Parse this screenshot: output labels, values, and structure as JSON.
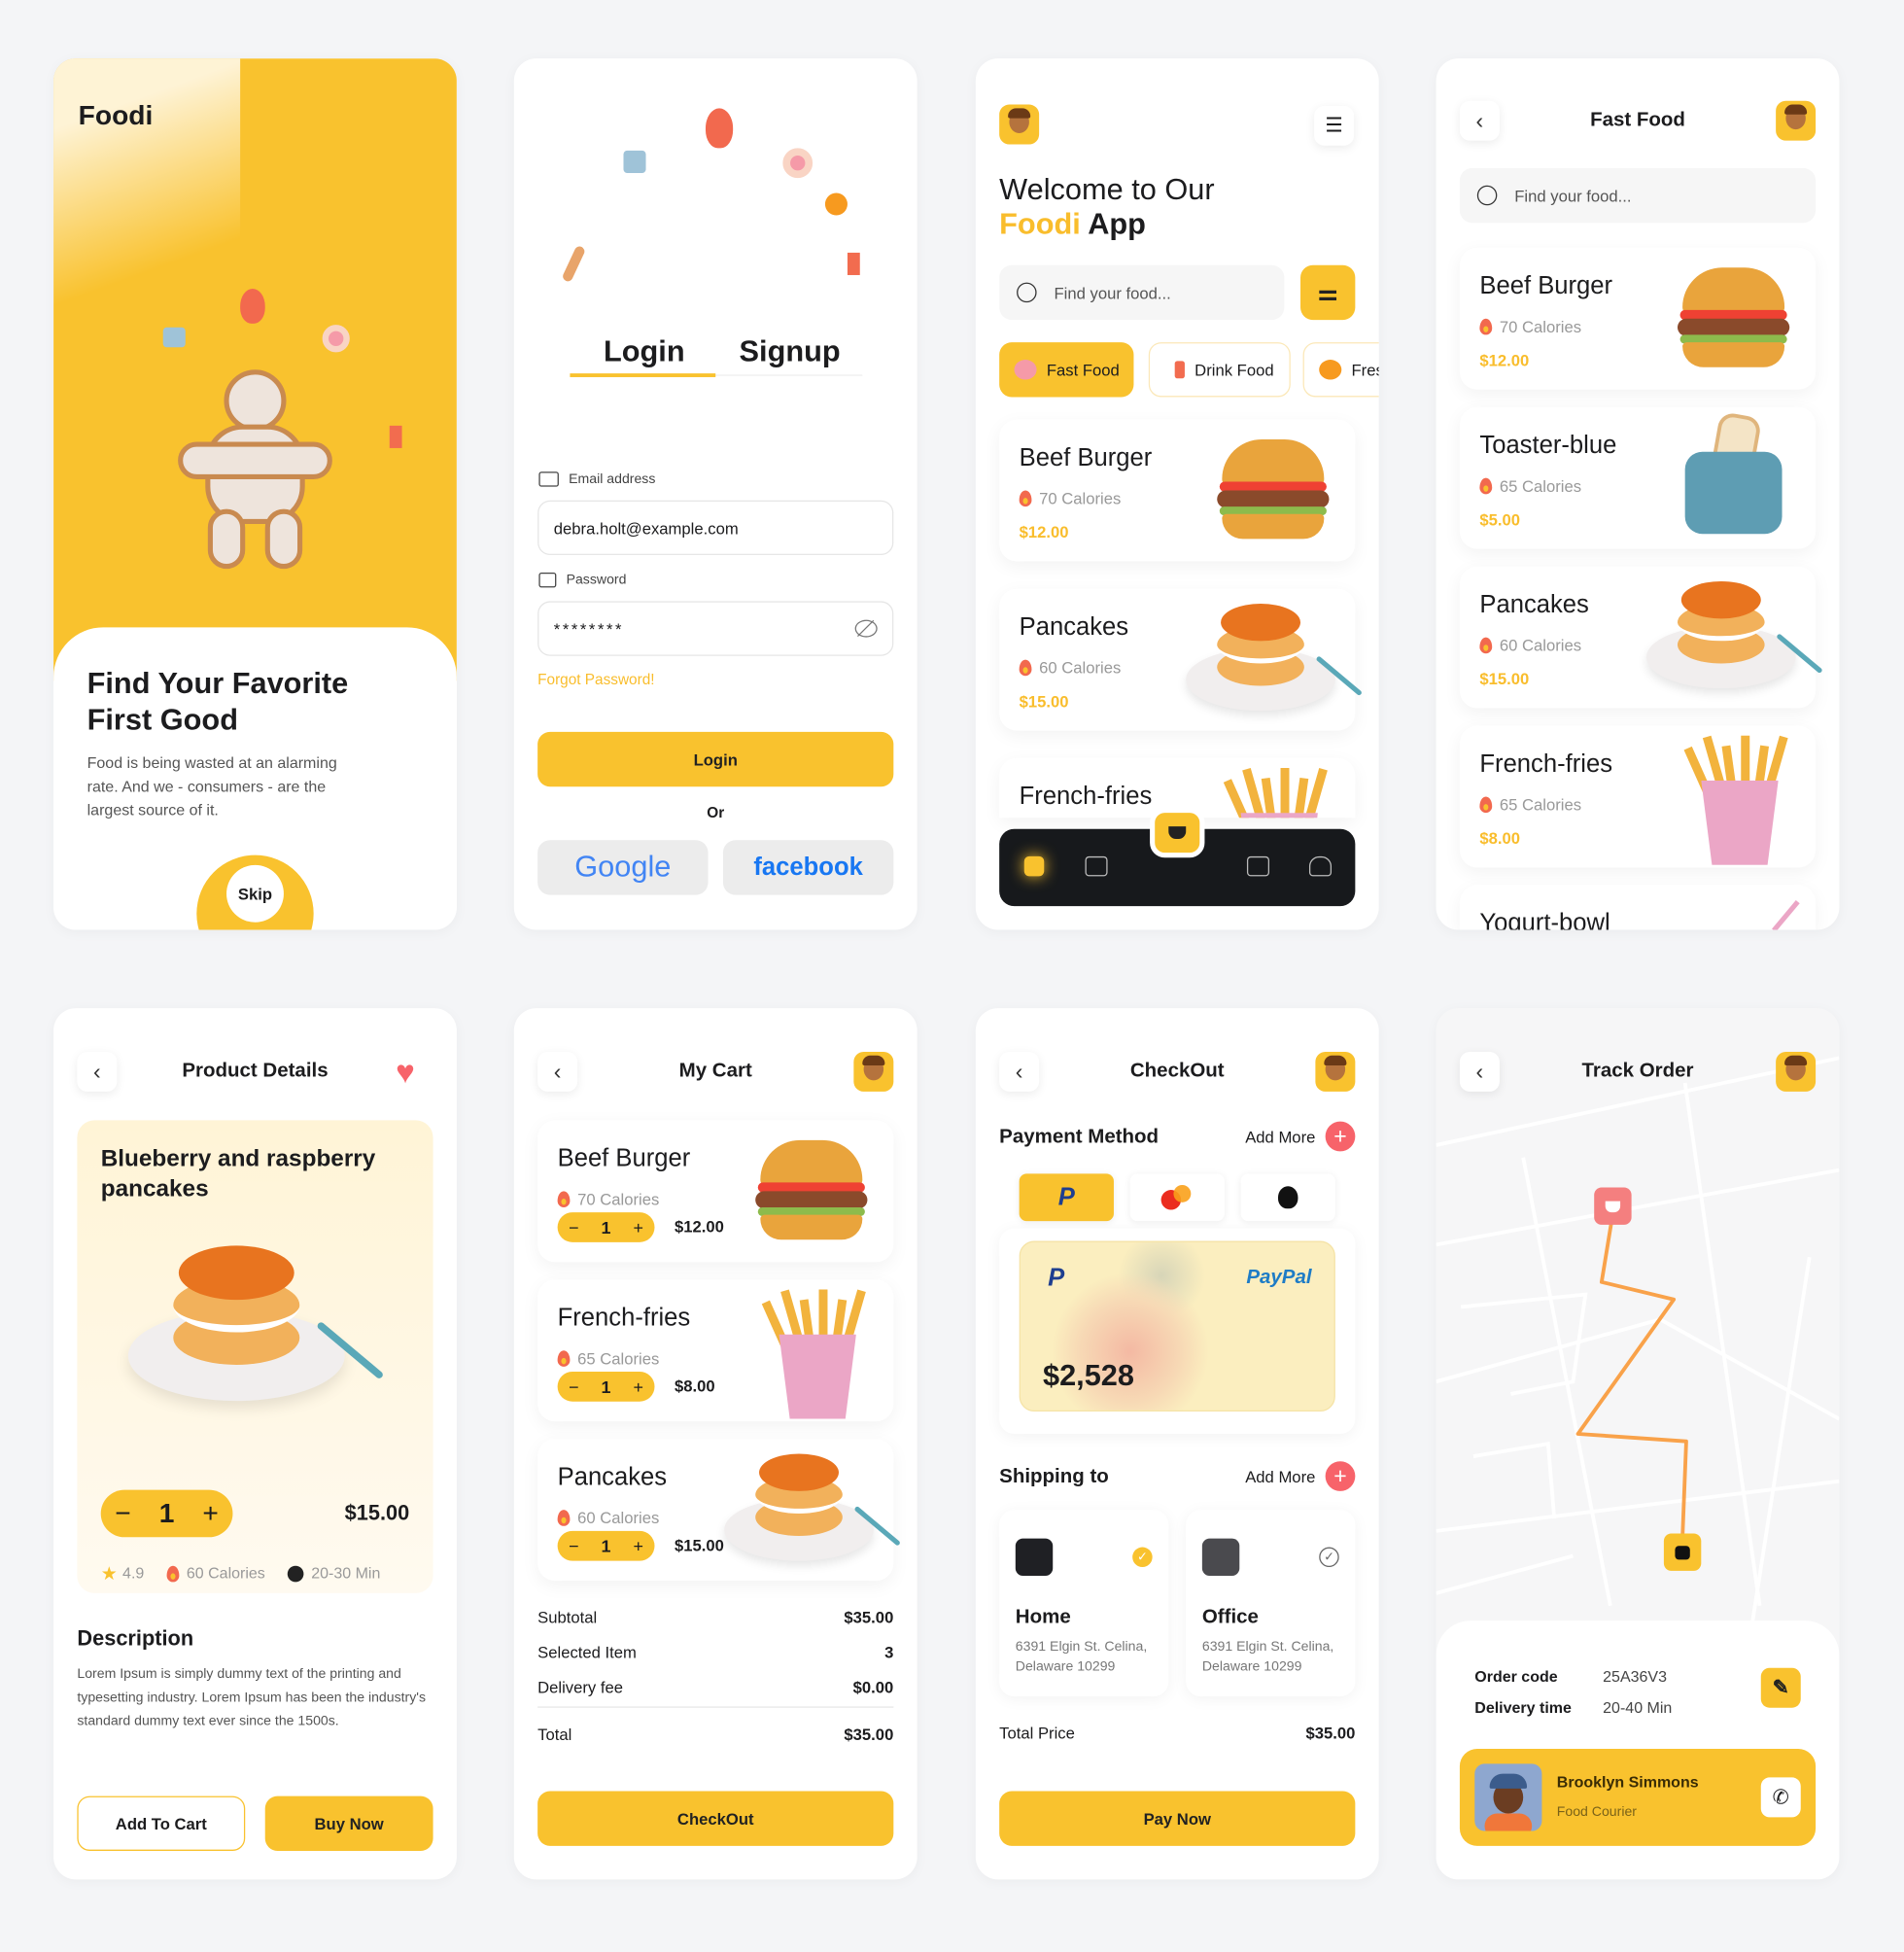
{
  "colors": {
    "accent": "#f9c22e",
    "price": "#f9bd2c",
    "danger": "#f7636a",
    "dark": "#17191c",
    "text": "#1c1c1e",
    "muted": "#999999"
  },
  "onboarding": {
    "logo": "Foodi",
    "title_line1": "Find Your Favorite",
    "title_line2": "First Good",
    "description": "Food is being wasted at an alarming rate. And we - consumers - are the largest source of it.",
    "skip": "Skip"
  },
  "login": {
    "tab_login": "Login",
    "tab_signup": "Signup",
    "email_label": "Email address",
    "email_value": "debra.holt@example.com",
    "password_label": "Password",
    "password_value": "********",
    "forgot": "Forgot Password!",
    "login_button": "Login",
    "or": "Or",
    "google": "Google",
    "facebook": "facebook"
  },
  "home": {
    "title_line1": "Welcome to Our",
    "title_brand": "Foodi",
    "title_app": "App",
    "search_placeholder": "Find your food...",
    "categories": [
      {
        "label": "Fast Food",
        "active": true
      },
      {
        "label": "Drink Food",
        "active": false
      },
      {
        "label": "Fresh",
        "active": false
      }
    ],
    "items": [
      {
        "name": "Beef Burger",
        "calories": "70 Calories",
        "price": "$12.00",
        "art": "burger"
      },
      {
        "name": "Pancakes",
        "calories": "60 Calories",
        "price": "$15.00",
        "art": "pancakes"
      },
      {
        "name": "French-fries",
        "calories": "",
        "price": "",
        "art": "fries"
      }
    ],
    "nav_icons": [
      "home-icon",
      "book-icon",
      "basket-icon",
      "bookmark-icon",
      "bell-icon"
    ]
  },
  "fast_food": {
    "title": "Fast Food",
    "search_placeholder": "Find your food...",
    "items": [
      {
        "name": "Beef Burger",
        "calories": "70 Calories",
        "price": "$12.00",
        "art": "burger"
      },
      {
        "name": "Toaster-blue",
        "calories": "65 Calories",
        "price": "$5.00",
        "art": "toaster"
      },
      {
        "name": "Pancakes",
        "calories": "60 Calories",
        "price": "$15.00",
        "art": "pancakes"
      },
      {
        "name": "French-fries",
        "calories": "65 Calories",
        "price": "$8.00",
        "art": "fries"
      },
      {
        "name": "Yogurt-bowl",
        "calories": "",
        "price": "",
        "art": "yogurt"
      }
    ]
  },
  "product": {
    "title": "Product Details",
    "name": "Blueberry and raspberry pancakes",
    "quantity": "1",
    "price": "$15.00",
    "rating": "4.9",
    "calories": "60 Calories",
    "time": "20-30 Min",
    "description_heading": "Description",
    "description": "Lorem Ipsum is simply dummy text of the printing and typesetting industry. Lorem Ipsum has been the industry's standard dummy text ever since the 1500s.",
    "add_to_cart": "Add To Cart",
    "buy_now": "Buy Now",
    "favorite": true
  },
  "cart": {
    "title": "My Cart",
    "items": [
      {
        "name": "Beef Burger",
        "calories": "70 Calories",
        "quantity": "1",
        "price": "$12.00",
        "art": "burger"
      },
      {
        "name": "French-fries",
        "calories": "65 Calories",
        "quantity": "1",
        "price": "$8.00",
        "art": "fries"
      },
      {
        "name": "Pancakes",
        "calories": "60 Calories",
        "quantity": "1",
        "price": "$15.00",
        "art": "pancakes"
      }
    ],
    "summary": [
      {
        "label": "Subtotal",
        "value": "$35.00"
      },
      {
        "label": "Selected Item",
        "value": "3"
      },
      {
        "label": "Delivery fee",
        "value": "$0.00"
      }
    ],
    "total_label": "Total",
    "total_value": "$35.00",
    "checkout": "CheckOut"
  },
  "checkout": {
    "title": "CheckOut",
    "payment_heading": "Payment Method",
    "add_more": "Add More",
    "payment_methods": [
      "paypal",
      "mastercard",
      "apple-pay"
    ],
    "selected_method": "paypal",
    "card_brand": "PayPal",
    "card_balance": "$2,528",
    "shipping_heading": "Shipping to",
    "addresses": [
      {
        "name": "Home",
        "address": "6391 Elgin St. Celina, Delaware 10299",
        "selected": true
      },
      {
        "name": "Office",
        "address": "6391 Elgin St. Celina, Delaware 10299",
        "selected": false
      }
    ],
    "total_label": "Total Price",
    "total_value": "$35.00",
    "pay_now": "Pay Now"
  },
  "track": {
    "title": "Track Order",
    "order_code_label": "Order code",
    "order_code": "25A36V3",
    "delivery_time_label": "Delivery time",
    "delivery_time": "20-40 Min",
    "courier_name": "Brooklyn Simmons",
    "courier_role": "Food Courier"
  }
}
